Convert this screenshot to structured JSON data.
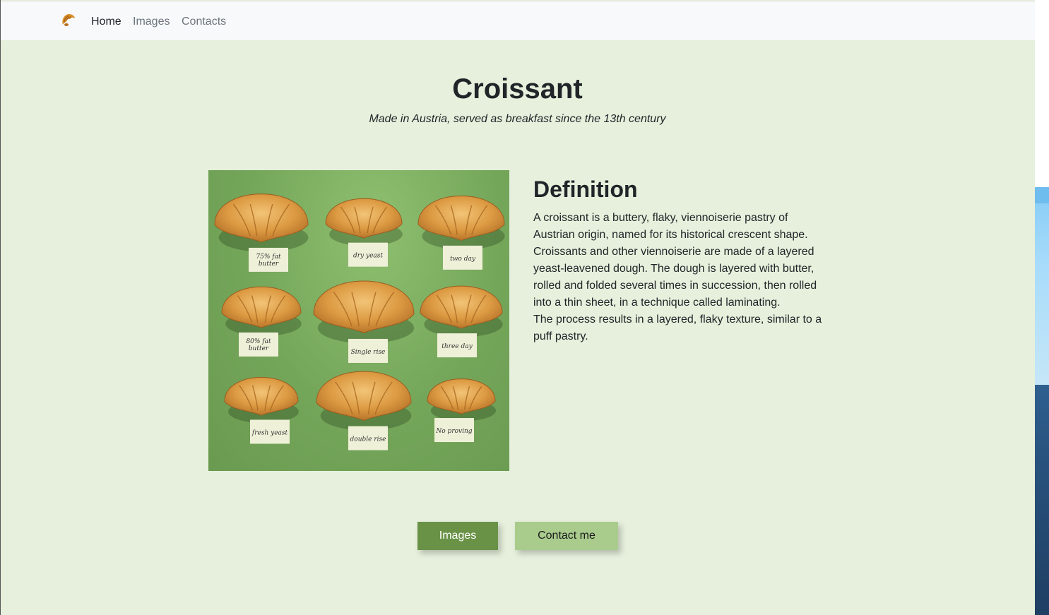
{
  "navbar": {
    "brand_icon": "croissant-icon",
    "links": [
      {
        "label": "Home",
        "active": true
      },
      {
        "label": "Images",
        "active": false
      },
      {
        "label": "Contacts",
        "active": false
      }
    ]
  },
  "hero": {
    "title": "Croissant",
    "subtitle": "Made in Austria, served as breakfast since the 13th century"
  },
  "photo": {
    "labels": [
      "75% fat butter",
      "dry yeast",
      "two day",
      "80% fat butter",
      "Single rise",
      "three day",
      "fresh yeast",
      "double rise",
      "No proving"
    ]
  },
  "definition": {
    "heading": "Definition",
    "paragraph1": "A croissant is a buttery, flaky, viennoiserie pastry of Austrian origin, named for its historical crescent shape. Croissants and other viennoiserie are made of a layered yeast-leavened dough. The dough is layered with butter, rolled and folded several times in succession, then rolled into a thin sheet, in a technique called laminating.",
    "paragraph2": "The process results in a layered, flaky texture, similar to a puff pastry."
  },
  "buttons": {
    "images_label": "Images",
    "contact_label": "Contact me"
  },
  "colors": {
    "page_background": "#e6f0dc",
    "navbar_background": "#f8f9fa",
    "primary_button": "#6a9247",
    "secondary_button": "#a9cc8d",
    "photo_background": "#74a65a"
  }
}
